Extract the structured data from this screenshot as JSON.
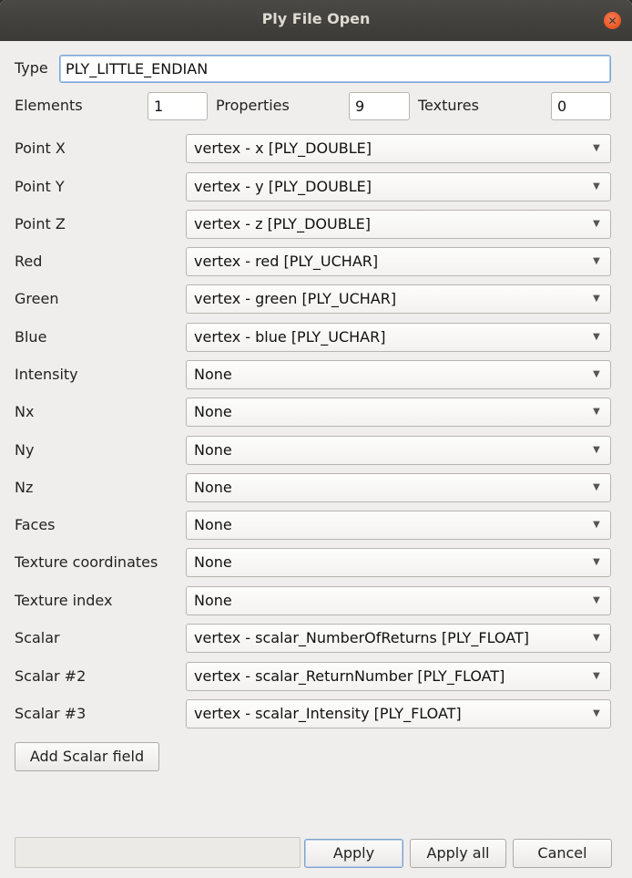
{
  "window": {
    "title": "Ply File Open"
  },
  "header": {
    "type_label": "Type",
    "type_value": "PLY_LITTLE_ENDIAN",
    "elements_label": "Elements",
    "elements_value": "1",
    "properties_label": "Properties",
    "properties_value": "9",
    "textures_label": "Textures",
    "textures_value": "0"
  },
  "mappings": [
    {
      "label": "Point X",
      "value": "vertex - x [PLY_DOUBLE]"
    },
    {
      "label": "Point Y",
      "value": "vertex - y [PLY_DOUBLE]"
    },
    {
      "label": "Point Z",
      "value": "vertex - z [PLY_DOUBLE]"
    },
    {
      "label": "Red",
      "value": "vertex - red [PLY_UCHAR]"
    },
    {
      "label": "Green",
      "value": "vertex - green [PLY_UCHAR]"
    },
    {
      "label": "Blue",
      "value": "vertex - blue [PLY_UCHAR]"
    },
    {
      "label": "Intensity",
      "value": "None"
    },
    {
      "label": "Nx",
      "value": "None"
    },
    {
      "label": "Ny",
      "value": "None"
    },
    {
      "label": "Nz",
      "value": "None"
    },
    {
      "label": "Faces",
      "value": "None"
    },
    {
      "label": "Texture coordinates",
      "value": "None"
    },
    {
      "label": "Texture index",
      "value": "None"
    },
    {
      "label": "Scalar",
      "value": "vertex - scalar_NumberOfReturns [PLY_FLOAT]"
    },
    {
      "label": "Scalar #2",
      "value": "vertex - scalar_ReturnNumber [PLY_FLOAT]"
    },
    {
      "label": "Scalar #3",
      "value": "vertex - scalar_Intensity [PLY_FLOAT]"
    }
  ],
  "actions": {
    "add_scalar_label": "Add Scalar field",
    "apply_label": "Apply",
    "apply_all_label": "Apply all",
    "cancel_label": "Cancel"
  },
  "icons": {
    "close": "close-icon",
    "dropdown": "chevron-down-icon"
  },
  "colors": {
    "titlebar": "#3b3a37",
    "close_button": "#e95420",
    "window_bg": "#efeeec"
  }
}
